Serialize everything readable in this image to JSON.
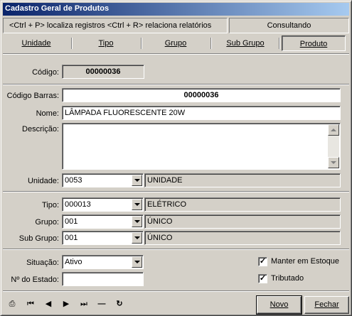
{
  "window": {
    "title": "Cadastro Geral de Produtos"
  },
  "info": {
    "shortcuts": "<Ctrl + P> localiza registros  <Ctrl + R> relaciona relatórios",
    "status": "Consultando"
  },
  "tabs": [
    "Unidade",
    "Tipo",
    "Grupo",
    "Sub Grupo",
    "Produto"
  ],
  "active_tab": "Produto",
  "form": {
    "codigo_label": "Código:",
    "codigo_value": "00000036",
    "codigo_barras_label": "Código Barras:",
    "codigo_barras_value": "00000036",
    "nome_label": "Nome:",
    "nome_value": "LÂMPADA FLUORESCENTE 20W",
    "descricao_label": "Descrição:",
    "descricao_value": "",
    "unidade_label": "Unidade:",
    "unidade_code": "0053",
    "unidade_desc": "UNIDADE",
    "tipo_label": "Tipo:",
    "tipo_code": "000013",
    "tipo_desc": "ELÉTRICO",
    "grupo_label": "Grupo:",
    "grupo_code": "001",
    "grupo_desc": "ÚNICO",
    "subgrupo_label": "Sub Grupo:",
    "subgrupo_code": "001",
    "subgrupo_desc": "ÚNICO",
    "situacao_label": "Situação:",
    "situacao_value": "Ativo",
    "num_estado_label": "Nº do Estado:",
    "num_estado_value": "",
    "manter_estoque_label": "Manter em Estoque",
    "manter_estoque_checked": true,
    "tributado_label": "Tributado",
    "tributado_checked": true
  },
  "footer": {
    "nav_icons": [
      "print-preview-icon",
      "first-record-icon",
      "prev-record-icon",
      "next-record-icon",
      "last-record-icon",
      "delete-record-icon",
      "refresh-icon"
    ],
    "nav_glyphs": [
      "⎙",
      "⏮",
      "◀",
      "▶",
      "⏭",
      "—",
      "↻"
    ],
    "novo_label": "Novo",
    "fechar_label": "Fechar"
  }
}
